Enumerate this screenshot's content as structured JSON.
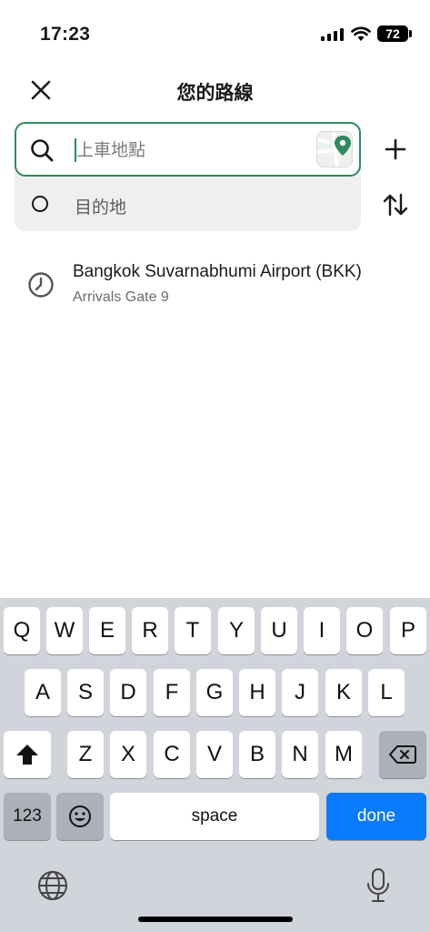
{
  "status_bar": {
    "time": "17:23",
    "battery": "72"
  },
  "header": {
    "title": "您的路線",
    "close_icon": "close-icon"
  },
  "route": {
    "pickup_placeholder": "上車地點",
    "pickup_value": "",
    "destination_label": "目的地",
    "pin_color": "#2f8a5c"
  },
  "recent": [
    {
      "title": "Bangkok Suvarnabhumi Airport (BKK)",
      "subtitle": "Arrivals Gate 9",
      "icon": "clock-icon"
    }
  ],
  "keyboard": {
    "row1": [
      "Q",
      "W",
      "E",
      "R",
      "T",
      "Y",
      "U",
      "I",
      "O",
      "P"
    ],
    "row2": [
      "A",
      "S",
      "D",
      "F",
      "G",
      "H",
      "J",
      "K",
      "L"
    ],
    "row3": [
      "Z",
      "X",
      "C",
      "V",
      "B",
      "N",
      "M"
    ],
    "numbers_label": "123",
    "space_label": "space",
    "done_label": "done"
  },
  "colors": {
    "accent_green": "#2f8a5c",
    "done_blue": "#0a7aff",
    "keyboard_bg": "#d1d4da"
  }
}
